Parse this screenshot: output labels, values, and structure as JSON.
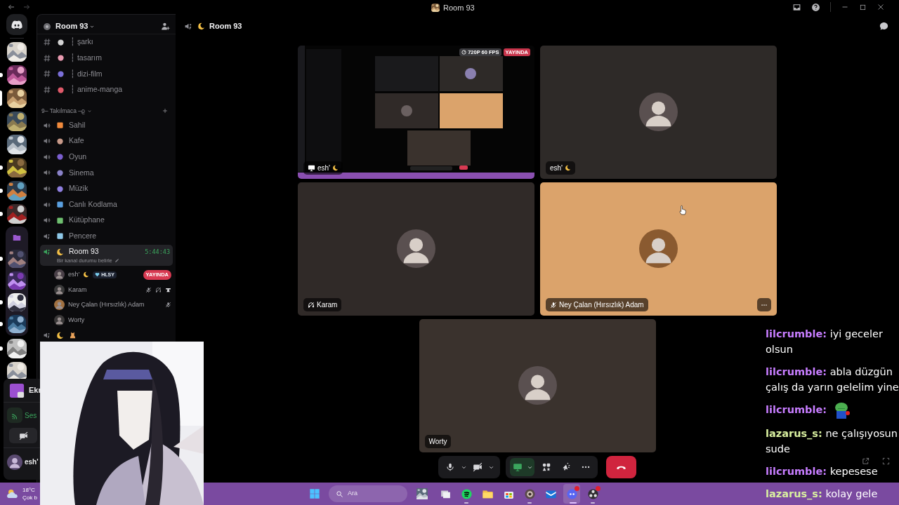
{
  "window": {
    "title": "Room 93"
  },
  "rail": [
    {
      "kind": "logo",
      "unread": false,
      "selected": false
    },
    {
      "kind": "server",
      "unread": false,
      "selected": false
    },
    {
      "kind": "server",
      "unread": true,
      "selected": false
    },
    {
      "kind": "server",
      "selected": true
    },
    {
      "kind": "server",
      "unread": false,
      "selected": false
    },
    {
      "kind": "server",
      "unread": false,
      "selected": false
    },
    {
      "kind": "server",
      "unread": true,
      "selected": false
    },
    {
      "kind": "server",
      "unread": true,
      "selected": false
    },
    {
      "kind": "server",
      "unread": true,
      "selected": false
    },
    {
      "kind": "folder",
      "children": [
        {
          "unread": true
        },
        {
          "unread": false
        },
        {
          "unread": true
        },
        {
          "unread": true
        }
      ]
    },
    {
      "kind": "server",
      "unread": true,
      "selected": false
    },
    {
      "kind": "server",
      "unread": false,
      "selected": false
    }
  ],
  "server": {
    "name": "Room 93"
  },
  "text_channels": [
    {
      "name": "┆ şarkı",
      "color": "#d4d4d4"
    },
    {
      "name": "┆ tasarım",
      "color": "#e89ab0"
    },
    {
      "name": "┆ dizi-film",
      "color": "#7b6fd8"
    },
    {
      "name": "┆ anime-manga",
      "color": "#e05a6a"
    }
  ],
  "category": {
    "name": "9– Takılmaca –ϱ",
    "expanded": true
  },
  "voice_channels": [
    {
      "name": "Sahil",
      "emojis": [
        {
          "kind": "square",
          "color": "#f08a3c"
        }
      ],
      "limited": false,
      "selected": false,
      "connected": false
    },
    {
      "name": "Kafe",
      "emojis": [
        {
          "kind": "round",
          "color": "#c89a8a"
        }
      ],
      "limited": false,
      "selected": false,
      "connected": false
    },
    {
      "name": "Oyun",
      "emojis": [
        {
          "kind": "round",
          "color": "#7b5fd0"
        }
      ],
      "limited": false,
      "selected": false,
      "connected": false
    },
    {
      "name": "Sinema",
      "emojis": [
        {
          "kind": "round",
          "color": "#8a82c8"
        }
      ],
      "limited": false,
      "selected": false,
      "connected": false
    },
    {
      "name": "Müzik",
      "emojis": [
        {
          "kind": "round",
          "color": "#8f7fe0"
        }
      ],
      "limited": false,
      "selected": false,
      "connected": false
    },
    {
      "name": "Canlı Kodlama",
      "emojis": [
        {
          "kind": "square",
          "color": "#5aa0e0"
        }
      ],
      "limited": false,
      "selected": false,
      "connected": false
    },
    {
      "name": "Kütüphane",
      "emojis": [
        {
          "kind": "square",
          "color": "#6fc070"
        }
      ],
      "limited": false,
      "selected": false,
      "connected": false
    },
    {
      "name": "Pencere",
      "emojis": [
        {
          "kind": "square",
          "color": "#8ec8e8"
        }
      ],
      "limited": true,
      "selected": false,
      "connected": false
    },
    {
      "name": "Room 93",
      "emojis": [
        {
          "kind": "moon"
        }
      ],
      "limited": true,
      "selected": true,
      "connected": true,
      "timer": "5:44:43",
      "status_placeholder": "Bir kanal durumu belirle",
      "members": [
        {
          "name": "esh'",
          "emojis": [
            {
              "kind": "moon"
            }
          ],
          "tag": "HLSY",
          "live": "YAYINDA",
          "muted": false,
          "deafened": false,
          "activity": false
        },
        {
          "name": "Karam",
          "muted": true,
          "deafened": true,
          "activity": true
        },
        {
          "name": "Ney Çalan (Hırsızlık) Adam",
          "muted": true,
          "deafened": false,
          "activity": false
        },
        {
          "name": "Worty",
          "muted": false,
          "deafened": false,
          "activity": false
        }
      ]
    },
    {
      "emojis": [
        {
          "kind": "moon"
        },
        {
          "kind": "cat"
        }
      ],
      "limited": true,
      "selected": false,
      "connected": false
    }
  ],
  "user_panel": {
    "stream_title": "Ekr",
    "voice_status": "Ses",
    "username": "esh'"
  },
  "header": {
    "title": "Room 93"
  },
  "tiles": [
    {
      "kind": "stream",
      "name": "esh'",
      "quality": "720P 60 FPS",
      "live": "YAYINDA",
      "color": "#000000"
    },
    {
      "kind": "camera",
      "name": "esh'",
      "color": "#2e2a28"
    },
    {
      "kind": "camera",
      "name": "Karam",
      "deafened": true,
      "color": "#302a28"
    },
    {
      "kind": "camera",
      "name": "Ney Çalan (Hırsızlık) Adam",
      "muted": true,
      "color": "#dba36b",
      "menu": true
    },
    {
      "kind": "camera",
      "name": "Worty",
      "color": "#3a322d"
    }
  ],
  "controls": {
    "mic_muted": false,
    "camera_off": true,
    "screen_sharing": true
  },
  "chat": [
    {
      "user": "lilcrumble:",
      "color": "#c77dff",
      "kind": "text",
      "text": "iyi geceler olsun"
    },
    {
      "user": "lilcrumble:",
      "color": "#c77dff",
      "kind": "text",
      "text": "abla düzgün çalış da yarın gelelim yine"
    },
    {
      "user": "lilcrumble:",
      "color": "#c77dff",
      "kind": "emote"
    },
    {
      "user": "lazarus_s:",
      "color": "#d9f0a0",
      "kind": "text",
      "text": "ne çalışıyosun sude"
    },
    {
      "user": "lilcrumble:",
      "color": "#c77dff",
      "kind": "text",
      "text": "kepesese"
    },
    {
      "user": "lazarus_s:",
      "color": "#d9f0a0",
      "kind": "text",
      "text": "kolay gele"
    }
  ],
  "taskbar": {
    "temperature": "18°C",
    "weather": "Çok b",
    "search_placeholder": "Ara",
    "apps": [
      {
        "kind": "picture",
        "running": false,
        "active": false,
        "badge": false
      },
      {
        "kind": "windows",
        "running": false,
        "active": false,
        "badge": false
      },
      {
        "kind": "spotify",
        "running": true,
        "active": false,
        "badge": false
      },
      {
        "kind": "folder",
        "running": false,
        "active": false,
        "badge": false
      },
      {
        "kind": "store",
        "running": false,
        "active": false,
        "badge": false
      },
      {
        "kind": "camera",
        "running": true,
        "active": false,
        "badge": false
      },
      {
        "kind": "mail",
        "running": false,
        "active": false,
        "badge": false
      },
      {
        "kind": "discord",
        "running": true,
        "active": true,
        "badge": true
      },
      {
        "kind": "obs",
        "running": true,
        "active": false,
        "badge": true
      }
    ]
  }
}
